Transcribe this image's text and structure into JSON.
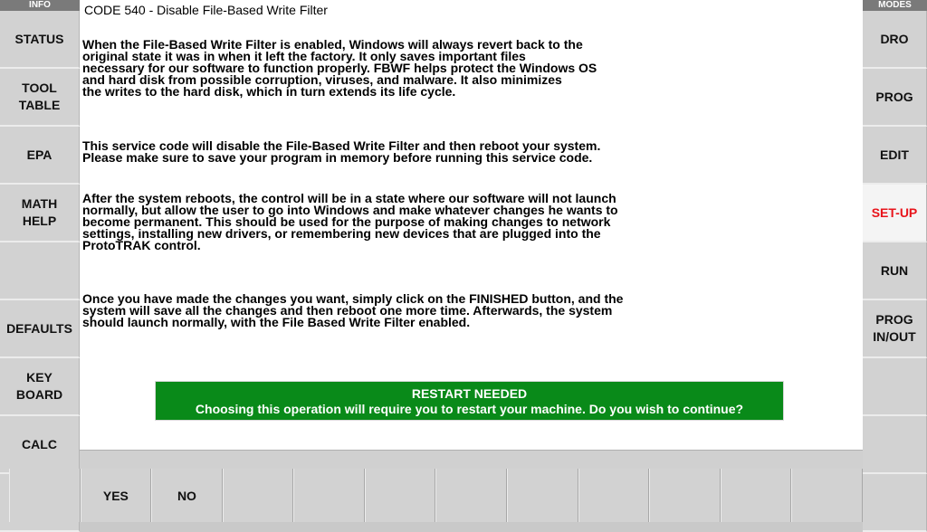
{
  "left_header": "INFO",
  "right_header": "MODES",
  "left_menu": [
    {
      "label": "STATUS"
    },
    {
      "label": "TOOL\nTABLE"
    },
    {
      "label": "EPA"
    },
    {
      "label": "MATH\nHELP"
    },
    {
      "label": ""
    },
    {
      "label": "DEFAULTS"
    },
    {
      "label": "KEY\nBOARD"
    },
    {
      "label": "CALC"
    },
    {
      "label": ""
    }
  ],
  "right_menu": [
    {
      "label": "DRO"
    },
    {
      "label": "PROG"
    },
    {
      "label": "EDIT"
    },
    {
      "label": "SET-UP",
      "active": true
    },
    {
      "label": "RUN"
    },
    {
      "label": "PROG\nIN/OUT"
    },
    {
      "label": ""
    },
    {
      "label": ""
    },
    {
      "label": ""
    }
  ],
  "main": {
    "title": "CODE 540 - Disable File-Based Write Filter",
    "paragraphs": [
      "When the File-Based Write Filter is enabled, Windows will always revert back to the\noriginal state it was in when it left the factory.  It only saves important files\nnecessary for our software to function properly.  FBWF helps protect the Windows OS\nand hard disk from possible corruption, viruses, and malware.  It also minimizes\nthe writes to the hard disk, which in turn extends its life cycle.",
      "This service code will disable the File-Based Write Filter and then reboot your system.\nPlease make sure to save your program in memory before running this service code.",
      "After the system reboots, the control will be in a state where our software will not launch\nnormally, but allow the user to go into Windows and make whatever changes he wants to\nbecome permanent.  This should be used for the purpose of making changes to network\nsettings, installing new drivers, or remembering new devices that are plugged into the\nProtoTRAK control.",
      "Once you have made the changes you want, simply click on the FINISHED button, and the\nsystem will save all the changes and then reboot one more time.  Afterwards, the system\nshould launch normally, with the File Based Write Filter enabled."
    ],
    "alert_title": "RESTART NEEDED",
    "alert_message": "Choosing this operation will require you to restart your machine. Do you wish to continue?"
  },
  "bottom_buttons": [
    {
      "label": ""
    },
    {
      "label": "YES"
    },
    {
      "label": "NO"
    },
    {
      "label": ""
    },
    {
      "label": ""
    },
    {
      "label": ""
    },
    {
      "label": ""
    },
    {
      "label": ""
    },
    {
      "label": ""
    },
    {
      "label": ""
    },
    {
      "label": ""
    },
    {
      "label": ""
    }
  ],
  "colors": {
    "alert_bg": "#098a19",
    "active_mode": "#e8141b"
  }
}
